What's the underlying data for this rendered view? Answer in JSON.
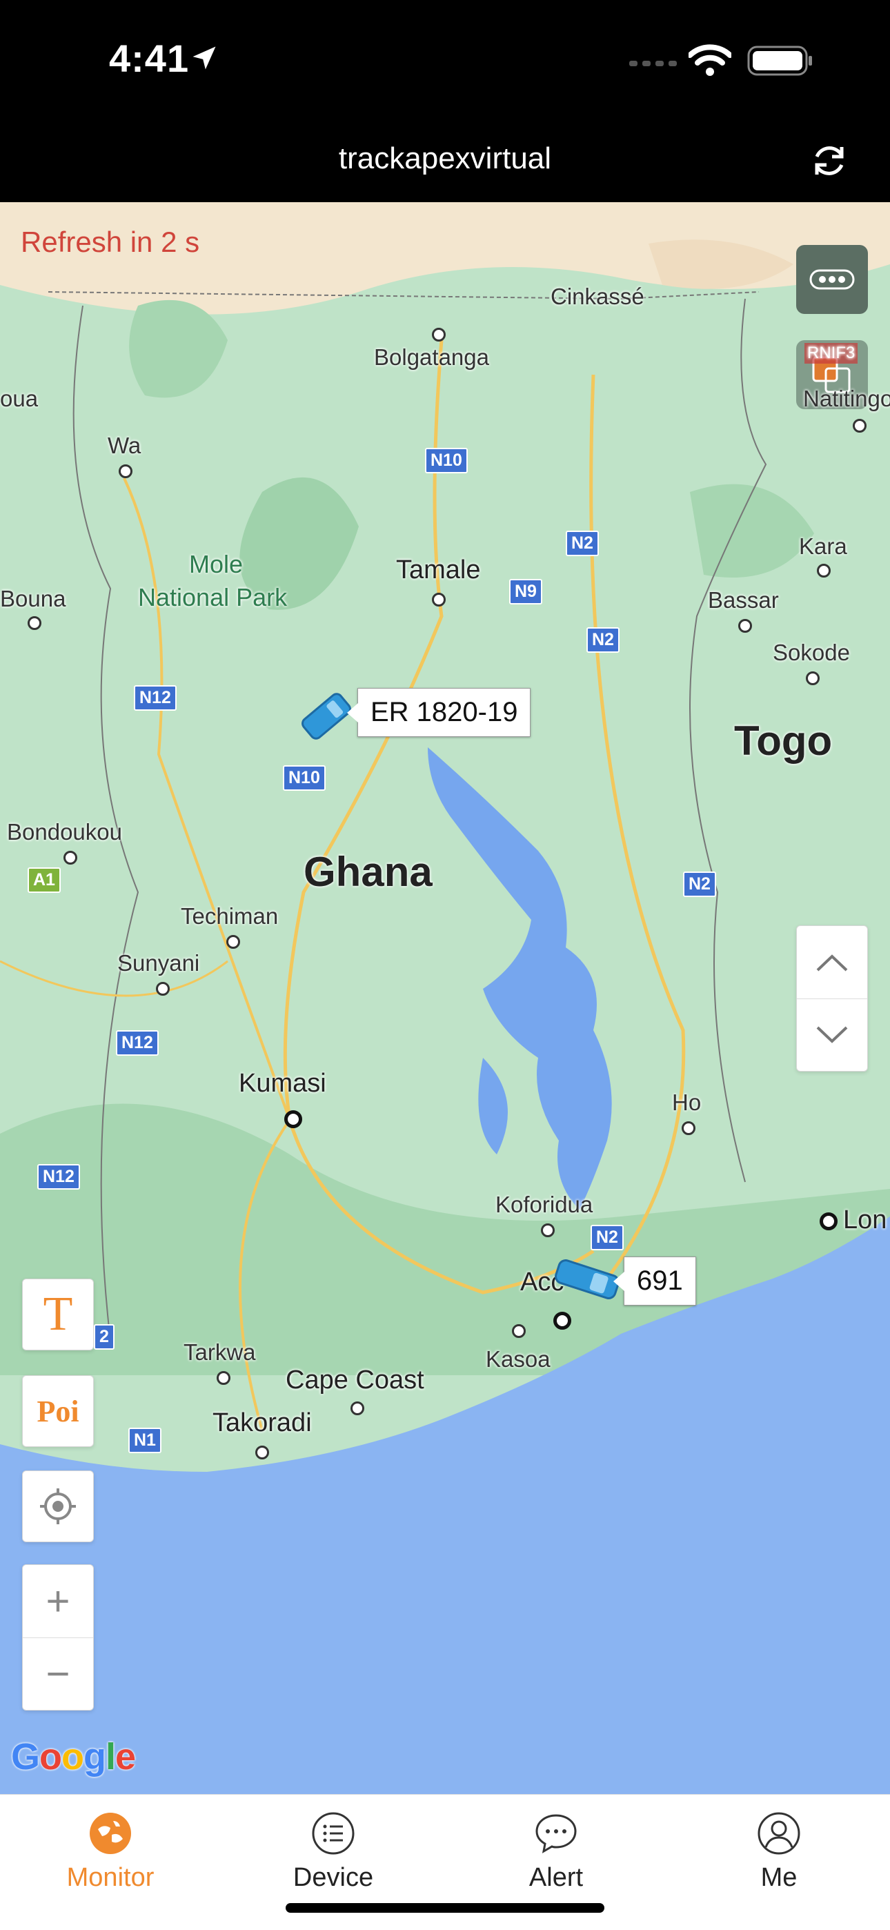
{
  "status_bar": {
    "time": "4:41"
  },
  "nav": {
    "title": "trackapexvirtual"
  },
  "map": {
    "refresh_text": "Refresh in 2 s",
    "country_labels": [
      "Ghana",
      "Togo"
    ],
    "park_label": [
      "Mole",
      "National Park"
    ],
    "cities": [
      "Cinkassé",
      "Bolgatanga",
      "Wa",
      "Tamale",
      "Kara",
      "Bassar",
      "Sokode",
      "Bouna",
      "Bondoukou",
      "Techiman",
      "Sunyani",
      "Kumasi",
      "Ho",
      "Koforidua",
      "Kasoa",
      "Tarkwa",
      "Cape Coast",
      "Takoradi",
      "Natitingo",
      "Acc",
      "Lon",
      "oua"
    ],
    "roads": [
      "N10",
      "N2",
      "N9",
      "N2",
      "N12",
      "N10",
      "N2",
      "N12",
      "N12",
      "N2",
      "N1",
      "A1",
      "2"
    ],
    "layer_badge": "RNIF3",
    "google": [
      "G",
      "o",
      "o",
      "g",
      "l",
      "e"
    ]
  },
  "vehicles": [
    {
      "name": "ER 1820-19"
    },
    {
      "name": "691"
    }
  ],
  "controls": {
    "text_button": "T",
    "poi_button": "Poi",
    "zoom_in": "+",
    "zoom_out": "−"
  },
  "tabs": [
    {
      "label": "Monitor",
      "icon": "monitor-icon",
      "active": true
    },
    {
      "label": "Device",
      "icon": "list-icon"
    },
    {
      "label": "Alert",
      "icon": "chat-bubble-icon"
    },
    {
      "label": "Me",
      "icon": "person-icon"
    }
  ],
  "colors": {
    "accent": "#f08a2e",
    "refresh_red": "#d0453b",
    "sea": "#8ab4f2",
    "land": "#bfe3c8",
    "road_badge": "#3d6fd0"
  }
}
